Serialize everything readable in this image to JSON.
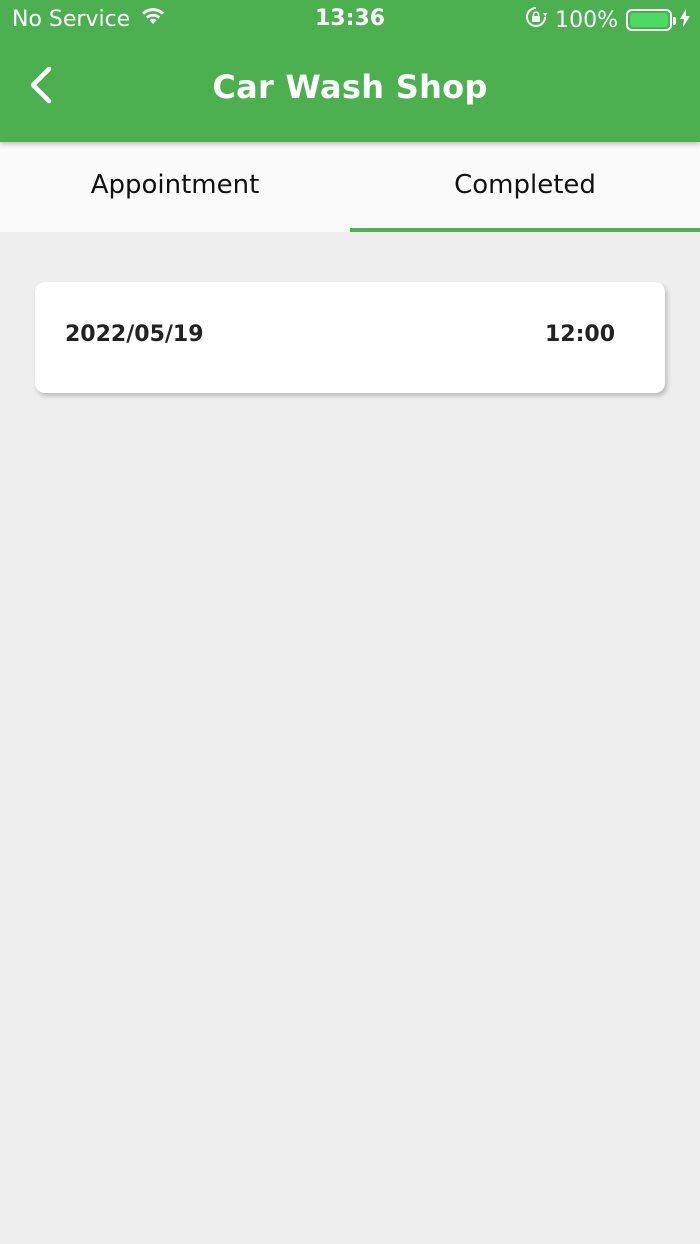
{
  "status_bar": {
    "carrier": "No Service",
    "time": "13:36",
    "battery_percent": "100%",
    "battery_level": 1.0,
    "icons": [
      "wifi-icon",
      "orientation-lock-icon",
      "battery-icon",
      "charging-icon"
    ]
  },
  "nav": {
    "title": "Car Wash Shop",
    "back_icon": "chevron-left-icon"
  },
  "tabs": [
    {
      "label": "Appointment",
      "active": false
    },
    {
      "label": "Completed",
      "active": true
    }
  ],
  "records": [
    {
      "date": "2022/05/19",
      "time": "12:00"
    }
  ],
  "colors": {
    "primary": "#4caf50",
    "background": "#eeeeee",
    "card": "#ffffff",
    "battery_fill": "#4cd964"
  }
}
